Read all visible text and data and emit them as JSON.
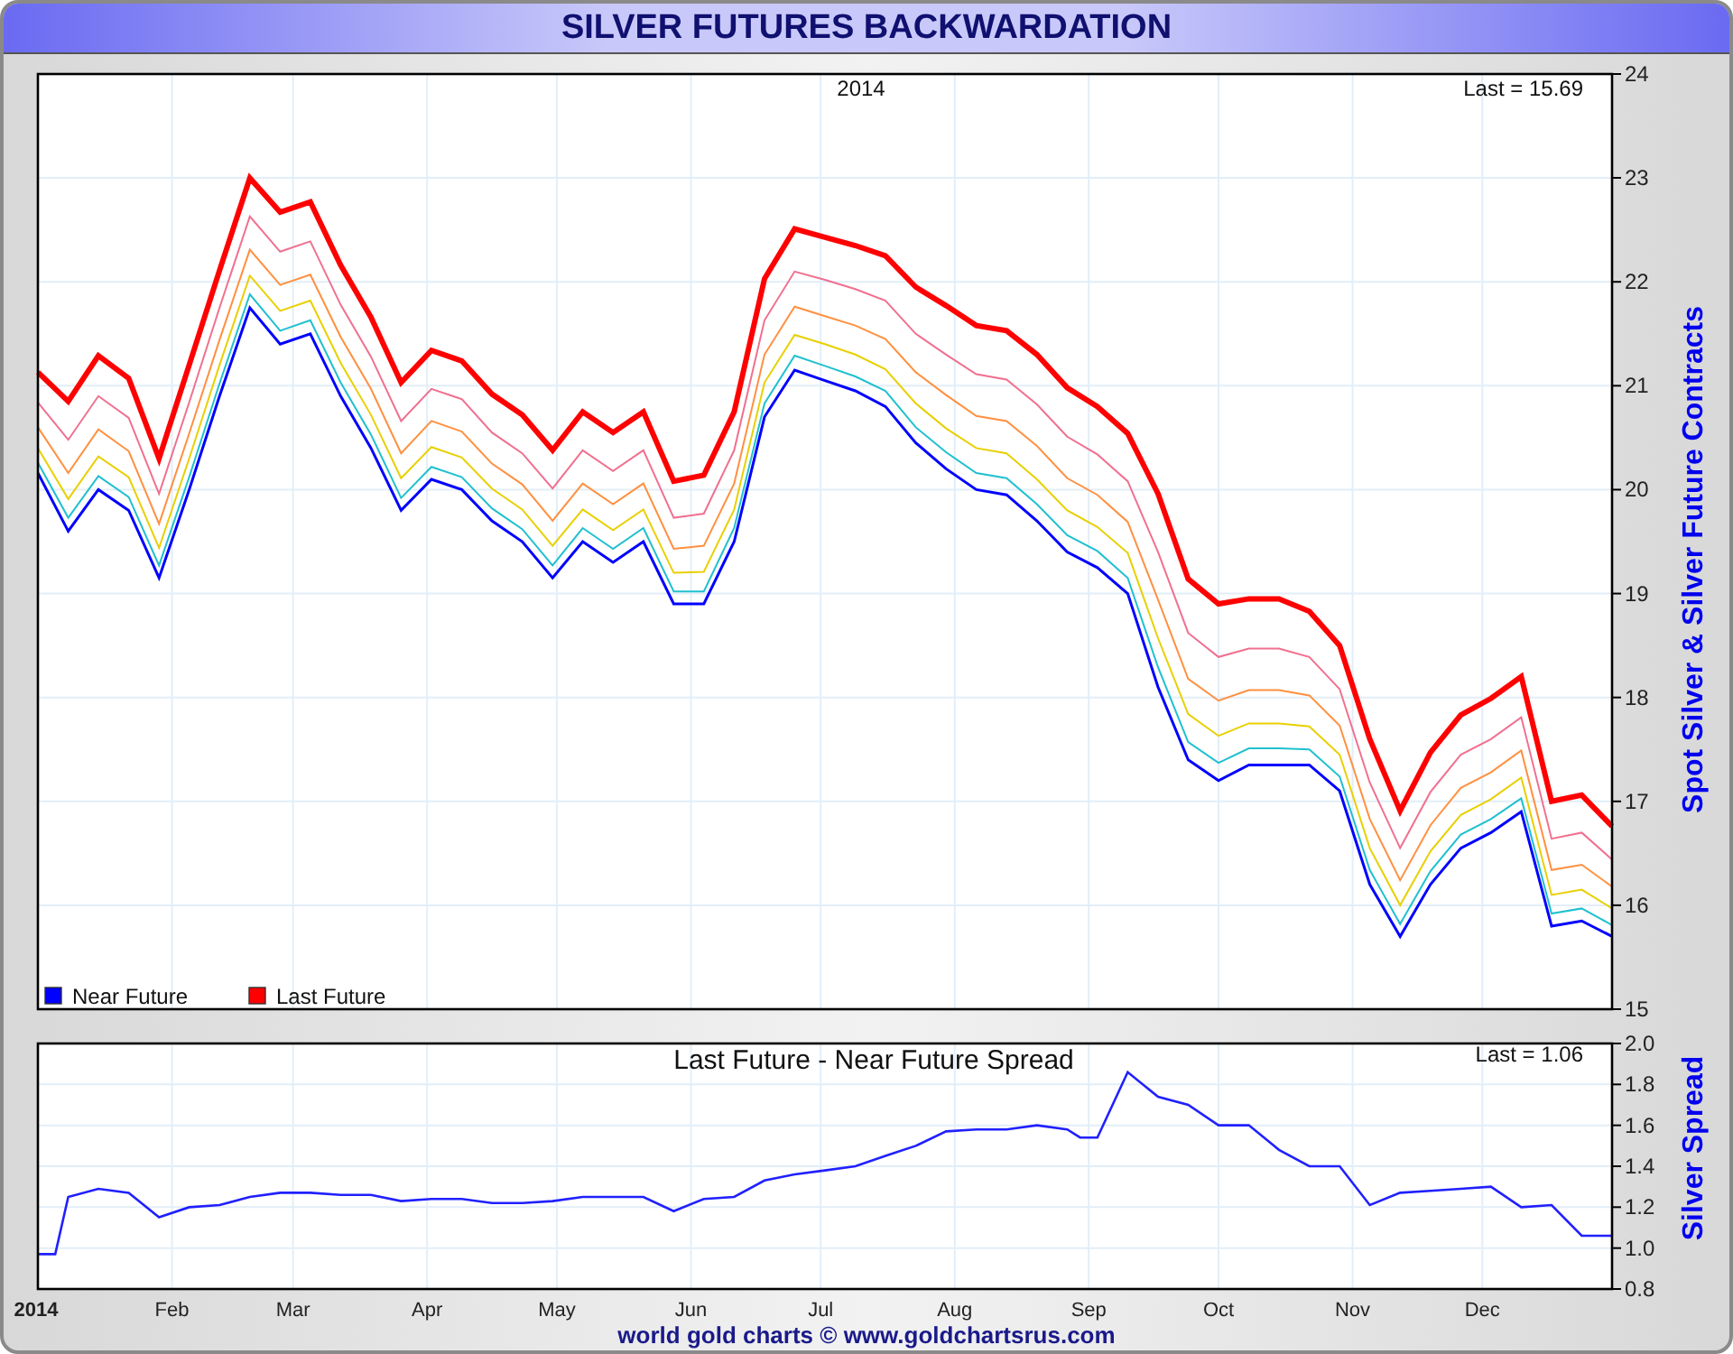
{
  "window": {
    "title": "SILVER FUTURES BACKWARDATION"
  },
  "price_panel": {
    "chart_data": {
      "type": "line",
      "grid": true,
      "legend": true,
      "title": "2014",
      "ylabel": "Spot Silver & Silver Future Contracts",
      "xlim": [
        "2014-01-01",
        "2014-12-31"
      ],
      "ylim": [
        15,
        24
      ],
      "yticks": [
        {
          "value": 15,
          "label": "15"
        },
        {
          "value": 16,
          "label": "16"
        },
        {
          "value": 17,
          "label": "17"
        },
        {
          "value": 18,
          "label": "18"
        },
        {
          "value": 19,
          "label": "19"
        },
        {
          "value": 20,
          "label": "20"
        },
        {
          "value": 21,
          "label": "21"
        },
        {
          "value": 22,
          "label": "22"
        },
        {
          "value": 23,
          "label": "23"
        },
        {
          "value": 24,
          "label": "24"
        }
      ],
      "x": [
        "2014-01-01",
        "2014-01-08",
        "2014-01-15",
        "2014-01-22",
        "2014-01-29",
        "2014-02-05",
        "2014-02-12",
        "2014-02-19",
        "2014-02-26",
        "2014-03-05",
        "2014-03-12",
        "2014-03-19",
        "2014-03-26",
        "2014-04-02",
        "2014-04-09",
        "2014-04-16",
        "2014-04-23",
        "2014-04-30",
        "2014-05-07",
        "2014-05-14",
        "2014-05-21",
        "2014-05-28",
        "2014-06-04",
        "2014-06-11",
        "2014-06-18",
        "2014-06-25",
        "2014-07-02",
        "2014-07-09",
        "2014-07-16",
        "2014-07-23",
        "2014-07-30",
        "2014-08-06",
        "2014-08-13",
        "2014-08-20",
        "2014-08-27",
        "2014-09-03",
        "2014-09-10",
        "2014-09-17",
        "2014-09-24",
        "2014-10-01",
        "2014-10-08",
        "2014-10-15",
        "2014-10-22",
        "2014-10-29",
        "2014-11-05",
        "2014-11-12",
        "2014-11-19",
        "2014-11-26",
        "2014-12-03",
        "2014-12-10",
        "2014-12-17",
        "2014-12-24",
        "2014-12-31"
      ],
      "series": [
        {
          "name": "Near Future",
          "color": "#0000ff",
          "values": [
            20.16,
            19.6,
            20.0,
            19.8,
            19.15,
            20.0,
            20.9,
            21.75,
            21.4,
            21.5,
            20.9,
            20.4,
            19.8,
            20.1,
            20.0,
            19.7,
            19.5,
            19.15,
            19.5,
            19.3,
            19.5,
            18.9,
            18.9,
            19.5,
            20.7,
            21.15,
            21.05,
            20.95,
            20.8,
            20.45,
            20.2,
            20.0,
            19.95,
            19.7,
            19.4,
            19.25,
            19.0,
            18.1,
            17.4,
            17.2,
            17.35,
            17.35,
            17.35,
            17.1,
            16.2,
            15.7,
            16.2,
            16.55,
            16.7,
            16.9,
            15.8,
            15.85,
            15.7
          ]
        },
        {
          "color": "#20c0d0",
          "values": [
            20.26,
            19.73,
            20.13,
            19.93,
            19.27,
            20.12,
            21.02,
            21.88,
            21.53,
            21.63,
            21.03,
            20.53,
            19.92,
            20.22,
            20.12,
            19.82,
            19.62,
            19.27,
            19.63,
            19.43,
            19.63,
            19.02,
            19.02,
            19.63,
            20.83,
            21.29,
            21.19,
            21.09,
            20.95,
            20.6,
            20.36,
            20.16,
            20.11,
            19.86,
            19.56,
            19.41,
            19.15,
            18.29,
            17.57,
            17.37,
            17.51,
            17.51,
            17.5,
            17.24,
            16.34,
            15.82,
            16.33,
            16.68,
            16.83,
            17.03,
            15.92,
            15.97,
            15.81
          ]
        },
        {
          "color": "#e8d000",
          "values": [
            20.4,
            19.91,
            20.32,
            20.12,
            19.44,
            20.3,
            21.2,
            22.06,
            21.72,
            21.82,
            21.22,
            20.72,
            20.11,
            20.41,
            20.31,
            20.01,
            19.81,
            19.46,
            19.81,
            19.61,
            19.81,
            19.2,
            19.21,
            19.81,
            21.03,
            21.49,
            21.4,
            21.3,
            21.16,
            20.83,
            20.59,
            20.4,
            20.35,
            20.1,
            19.8,
            19.64,
            19.39,
            18.57,
            17.84,
            17.63,
            17.75,
            17.75,
            17.72,
            17.45,
            16.55,
            16.0,
            16.52,
            16.87,
            17.02,
            17.23,
            16.1,
            16.15,
            15.97
          ]
        },
        {
          "color": "#ff9040",
          "values": [
            20.6,
            20.16,
            20.58,
            20.37,
            19.67,
            20.54,
            21.44,
            22.31,
            21.97,
            22.07,
            21.47,
            20.97,
            20.35,
            20.66,
            20.56,
            20.25,
            20.05,
            19.7,
            20.06,
            19.86,
            20.06,
            19.43,
            19.46,
            20.06,
            21.3,
            21.76,
            21.67,
            21.58,
            21.45,
            21.13,
            20.91,
            20.71,
            20.66,
            20.42,
            20.11,
            19.95,
            19.69,
            18.94,
            18.18,
            17.97,
            18.07,
            18.07,
            18.02,
            17.73,
            16.83,
            16.24,
            16.77,
            17.13,
            17.28,
            17.49,
            16.34,
            16.39,
            16.18
          ]
        },
        {
          "color": "#f07090",
          "values": [
            20.84,
            20.48,
            20.9,
            20.69,
            19.96,
            20.84,
            21.75,
            22.63,
            22.29,
            22.39,
            21.78,
            21.28,
            20.66,
            20.97,
            20.87,
            20.55,
            20.35,
            20.01,
            20.38,
            20.18,
            20.38,
            19.73,
            19.77,
            20.38,
            21.63,
            22.1,
            22.02,
            21.93,
            21.82,
            21.5,
            21.3,
            21.11,
            21.06,
            20.82,
            20.51,
            20.34,
            20.08,
            19.4,
            18.62,
            18.39,
            18.47,
            18.47,
            18.39,
            18.08,
            17.18,
            16.55,
            17.09,
            17.45,
            17.6,
            17.81,
            16.64,
            16.7,
            16.44
          ]
        },
        {
          "name": "Last Future",
          "color": "#ff0000",
          "values": [
            21.13,
            20.85,
            21.29,
            21.07,
            20.3,
            21.2,
            22.11,
            23.0,
            22.67,
            22.77,
            22.16,
            21.66,
            21.03,
            21.34,
            21.24,
            20.92,
            20.72,
            20.38,
            20.75,
            20.55,
            20.75,
            20.08,
            20.14,
            20.75,
            22.03,
            22.51,
            22.43,
            22.35,
            22.25,
            21.95,
            21.77,
            21.58,
            21.53,
            21.3,
            20.98,
            20.8,
            20.54,
            19.96,
            19.14,
            18.9,
            18.95,
            18.95,
            18.83,
            18.5,
            17.6,
            16.91,
            17.47,
            17.83,
            17.99,
            18.2,
            17.0,
            17.06,
            16.76
          ]
        }
      ],
      "annotations": [
        {
          "text": "Last = 15.69"
        }
      ]
    }
  },
  "spread_panel": {
    "chart_data": {
      "type": "line",
      "grid": true,
      "title": "Last Future - Near Future Spread",
      "ylabel": "Silver Spread",
      "xlim": [
        "2014-01-01",
        "2014-12-31"
      ],
      "ylim": [
        0.8,
        2.0
      ],
      "yticks": [
        {
          "value": 0.8,
          "label": "0.8"
        },
        {
          "value": 1.0,
          "label": "1.0"
        },
        {
          "value": 1.2,
          "label": "1.2"
        },
        {
          "value": 1.4,
          "label": "1.4"
        },
        {
          "value": 1.6,
          "label": "1.6"
        },
        {
          "value": 1.8,
          "label": "1.8"
        },
        {
          "value": 2.0,
          "label": "2.0"
        }
      ],
      "xticks": [
        {
          "value": "2014-01-01",
          "label": "2014"
        },
        {
          "value": "2014-02-01",
          "label": "Feb"
        },
        {
          "value": "2014-03-01",
          "label": "Mar"
        },
        {
          "value": "2014-04-01",
          "label": "Apr"
        },
        {
          "value": "2014-05-01",
          "label": "May"
        },
        {
          "value": "2014-06-01",
          "label": "Jun"
        },
        {
          "value": "2014-07-01",
          "label": "Jul"
        },
        {
          "value": "2014-08-01",
          "label": "Aug"
        },
        {
          "value": "2014-09-01",
          "label": "Sep"
        },
        {
          "value": "2014-10-01",
          "label": "Oct"
        },
        {
          "value": "2014-11-01",
          "label": "Nov"
        },
        {
          "value": "2014-12-01",
          "label": "Dec"
        }
      ],
      "x": [
        "2014-01-01",
        "2014-01-05",
        "2014-01-08",
        "2014-01-15",
        "2014-01-22",
        "2014-01-29",
        "2014-02-05",
        "2014-02-12",
        "2014-02-19",
        "2014-02-26",
        "2014-03-05",
        "2014-03-12",
        "2014-03-19",
        "2014-03-26",
        "2014-04-02",
        "2014-04-09",
        "2014-04-16",
        "2014-04-23",
        "2014-04-30",
        "2014-05-07",
        "2014-05-14",
        "2014-05-21",
        "2014-05-28",
        "2014-06-04",
        "2014-06-11",
        "2014-06-18",
        "2014-06-25",
        "2014-07-02",
        "2014-07-09",
        "2014-07-16",
        "2014-07-23",
        "2014-07-30",
        "2014-08-06",
        "2014-08-13",
        "2014-08-20",
        "2014-08-27",
        "2014-08-30",
        "2014-09-03",
        "2014-09-10",
        "2014-09-17",
        "2014-09-24",
        "2014-10-01",
        "2014-10-08",
        "2014-10-15",
        "2014-10-22",
        "2014-10-29",
        "2014-11-05",
        "2014-11-12",
        "2014-11-19",
        "2014-11-26",
        "2014-12-03",
        "2014-12-10",
        "2014-12-17",
        "2014-12-24",
        "2014-12-31"
      ],
      "series": [
        {
          "color": "#2020ff",
          "values": [
            0.97,
            0.97,
            1.25,
            1.29,
            1.27,
            1.15,
            1.2,
            1.21,
            1.25,
            1.27,
            1.27,
            1.26,
            1.26,
            1.23,
            1.24,
            1.24,
            1.22,
            1.22,
            1.23,
            1.25,
            1.25,
            1.25,
            1.18,
            1.24,
            1.25,
            1.33,
            1.36,
            1.38,
            1.4,
            1.45,
            1.5,
            1.57,
            1.58,
            1.58,
            1.6,
            1.58,
            1.54,
            1.54,
            1.86,
            1.74,
            1.7,
            1.6,
            1.6,
            1.48,
            1.4,
            1.4,
            1.21,
            1.27,
            1.28,
            1.29,
            1.3,
            1.2,
            1.21,
            1.06,
            1.06
          ]
        }
      ],
      "annotations": [
        {
          "text": "Last = 1.06"
        }
      ]
    }
  },
  "footer": {
    "credit": "world gold charts © www.goldchartsrus.com"
  }
}
